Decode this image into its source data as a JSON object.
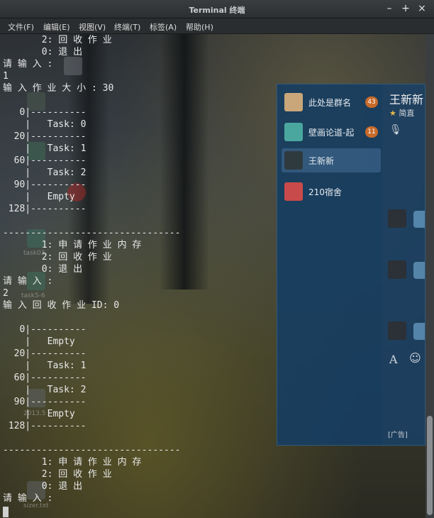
{
  "window": {
    "title": "Terminal 终端",
    "controls": {
      "minimize": "–",
      "maximize": "+",
      "close": "×"
    }
  },
  "menu": [
    {
      "label": "文件(F)"
    },
    {
      "label": "编辑(E)"
    },
    {
      "label": "视图(V)"
    },
    {
      "label": "终端(T)"
    },
    {
      "label": "标签(A)"
    },
    {
      "label": "帮助(H)"
    }
  ],
  "terminal": {
    "lines": [
      "       2: 回 收 作 业",
      "       0: 退 出",
      "请 输 入 :",
      "1",
      "输 入 作 业 大 小 : 30",
      "",
      "   0|----------",
      "    |   Task: 0",
      "  20|----------",
      "    |   Task: 1",
      "  60|----------",
      "    |   Task: 2",
      "  90|----------",
      "    |   Empty",
      " 128|----------",
      "",
      "--------------------------------",
      "       1: 申 请 作 业 内 存",
      "       2: 回 收 作 业",
      "       0: 退 出",
      "请 输 入 :",
      "2",
      "输 入 回 收 作 业 ID: 0",
      "",
      "   0|----------",
      "    |   Empty",
      "  20|----------",
      "    |   Task: 1",
      "  60|----------",
      "    |   Task: 2",
      "  90|----------",
      "    |   Empty",
      " 128|----------",
      "",
      "--------------------------------",
      "       1: 申 请 作 业 内 存",
      "       2: 回 收 作 业",
      "       0: 退 出",
      "请 输 入 :"
    ]
  },
  "desktop_labels": [
    "task03",
    "task5-6",
    "2013.5",
    "sizer.txt"
  ],
  "chat": {
    "conversations": [
      {
        "name": "此处是群名",
        "badge": "43"
      },
      {
        "name": "壁画论道-起",
        "badge": "11"
      },
      {
        "name": "王新新",
        "selected": true
      },
      {
        "name": "210宿舍"
      }
    ],
    "header_title": "王新新",
    "header_sub": "简直",
    "ad_text": "[广告]"
  },
  "colors": {
    "terminal_text": "#e9e9e9",
    "badge": "#c76a2a",
    "chat_bg": "#183a5c"
  }
}
